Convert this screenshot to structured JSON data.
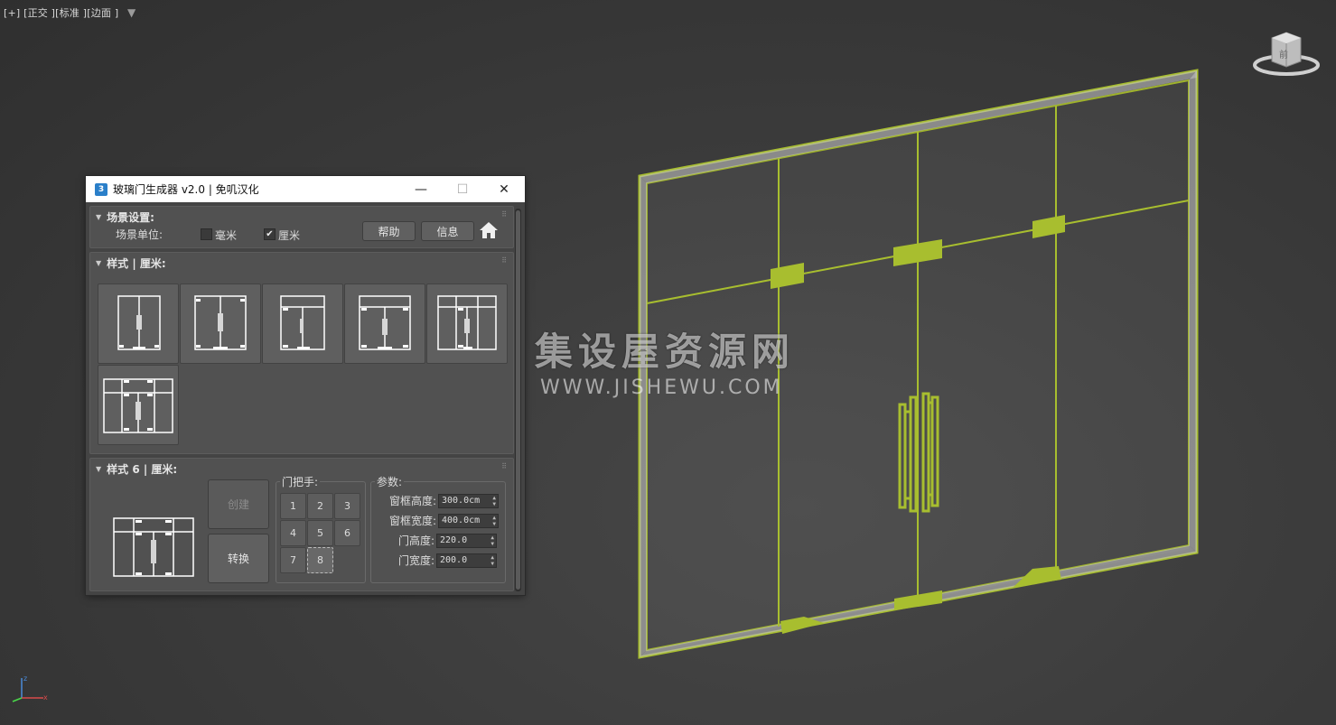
{
  "viewport": {
    "label": "[+] [正交 ][标准 ][边面 ]",
    "viewcube_face": "前"
  },
  "watermark": {
    "title": "集设屋资源网",
    "url": "WWW.JISHEWU.COM"
  },
  "axis": {
    "z": "z",
    "x": "x"
  },
  "colors": {
    "door_frame": "#a8be2f",
    "selection": "#c4d83a"
  },
  "dialog": {
    "title": "玻璃门生成器 v2.0 | 免叽汉化",
    "app_icon": "3",
    "minimize": "—",
    "maximize": "☐",
    "close": "✕",
    "scene_settings": {
      "header": "场景设置:",
      "unit_label": "场景单位:",
      "mm_label": "毫米",
      "mm_checked": false,
      "cm_label": "厘米",
      "cm_checked": true,
      "help_button": "帮助",
      "info_button": "信息",
      "home_icon": "house-icon"
    },
    "styles": {
      "header": "样式 | 厘米:",
      "items": [
        "style-1",
        "style-2",
        "style-3",
        "style-4",
        "style-5",
        "style-6"
      ]
    },
    "style6": {
      "header": "样式 6 | 厘米:",
      "create_button": "创建",
      "convert_button": "转换",
      "handle_group": "门把手:",
      "handle_buttons": [
        "1",
        "2",
        "3",
        "4",
        "5",
        "6",
        "7",
        "8"
      ],
      "handle_selected": "8",
      "params_group": "参数:",
      "params": [
        {
          "label": "窗框高度:",
          "value": "300.0cm"
        },
        {
          "label": "窗框宽度:",
          "value": "400.0cm"
        },
        {
          "label": "门高度:",
          "value": "220.0"
        },
        {
          "label": "门宽度:",
          "value": "200.0"
        }
      ]
    }
  }
}
